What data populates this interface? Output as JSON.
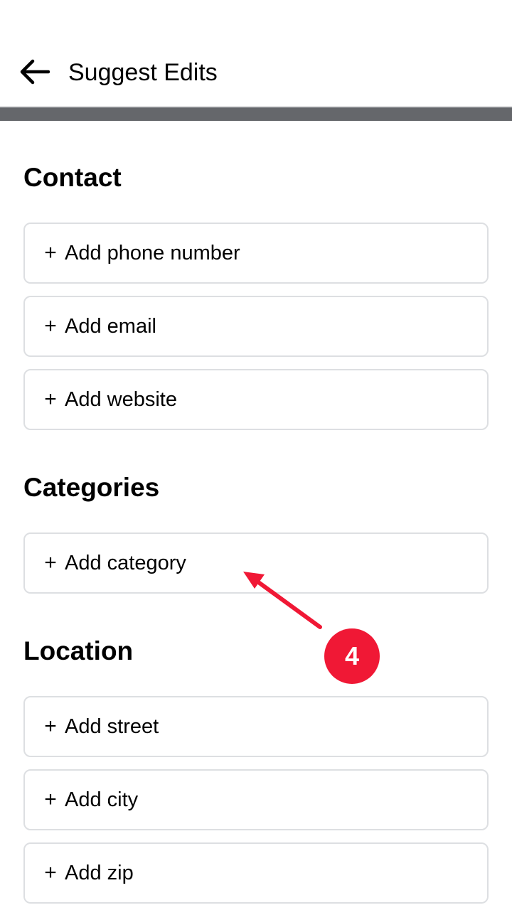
{
  "header": {
    "title": "Suggest Edits",
    "back_icon": "arrow-left-icon"
  },
  "sections": [
    {
      "title": "Contact",
      "items": [
        {
          "label": "Add phone number"
        },
        {
          "label": "Add email"
        },
        {
          "label": "Add website"
        }
      ]
    },
    {
      "title": "Categories",
      "items": [
        {
          "label": "Add category"
        }
      ]
    },
    {
      "title": "Location",
      "items": [
        {
          "label": "Add street"
        },
        {
          "label": "Add city"
        },
        {
          "label": "Add zip"
        }
      ]
    }
  ],
  "plus_symbol": "+",
  "annotation": {
    "step_number": "4",
    "color": "#f01835"
  }
}
